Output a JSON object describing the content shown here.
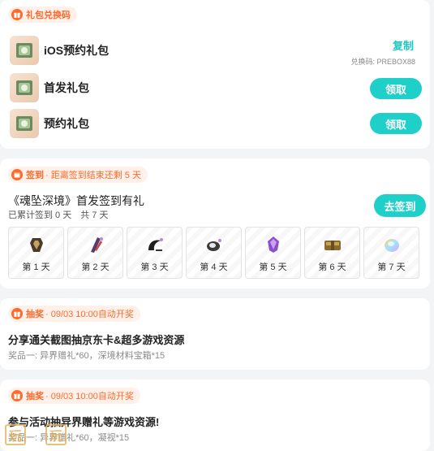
{
  "gift_section": {
    "tag_label": "礼包兑换码",
    "items": [
      {
        "name": "iOS预约礼包",
        "action": "复制",
        "code_label": "兑换码: PREBOX88"
      },
      {
        "name": "首发礼包",
        "action": "领取"
      },
      {
        "name": "预约礼包",
        "action": "领取"
      }
    ]
  },
  "signin_section": {
    "tag_label": "签到",
    "tag_sub": "· 距离签到结束还剩 5 天",
    "title": "《魂坠深境》首发签到有礼",
    "progress": "已累计签到 0 天　共 7 天",
    "button": "去签到",
    "days": [
      {
        "label": "第 1 天",
        "icon": "armor-icon"
      },
      {
        "label": "第 2 天",
        "icon": "crystal-blade-icon"
      },
      {
        "label": "第 3 天",
        "icon": "dark-claw-icon"
      },
      {
        "label": "第 4 天",
        "icon": "helmet-icon"
      },
      {
        "label": "第 5 天",
        "icon": "purple-crystal-icon"
      },
      {
        "label": "第 6 天",
        "icon": "material-box-icon"
      },
      {
        "label": "第 7 天",
        "icon": "rainbow-gem-icon"
      }
    ]
  },
  "lottery_1": {
    "tag_label": "抽奖",
    "tag_sub": "· 09/03 10:00自动开奖",
    "title": "分享通关截图抽京东卡&超多游戏资源",
    "prize_line": "奖品一: 异界赠礼*60，深境材料宝箱*15"
  },
  "lottery_2": {
    "tag_label": "抽奖",
    "tag_sub": "· 09/03 10:00自动开奖",
    "title": "参与活动抽异界赠礼等游戏资源!",
    "prize_line": "奖品一: 异界赠礼*60，凝视*15"
  },
  "watermark": {
    "chars": [
      "玩",
      "玩"
    ]
  },
  "colors": {
    "accent": "#1fd0c8",
    "tag": "#ff6a2a",
    "tag_bg": "#fff1ea"
  }
}
